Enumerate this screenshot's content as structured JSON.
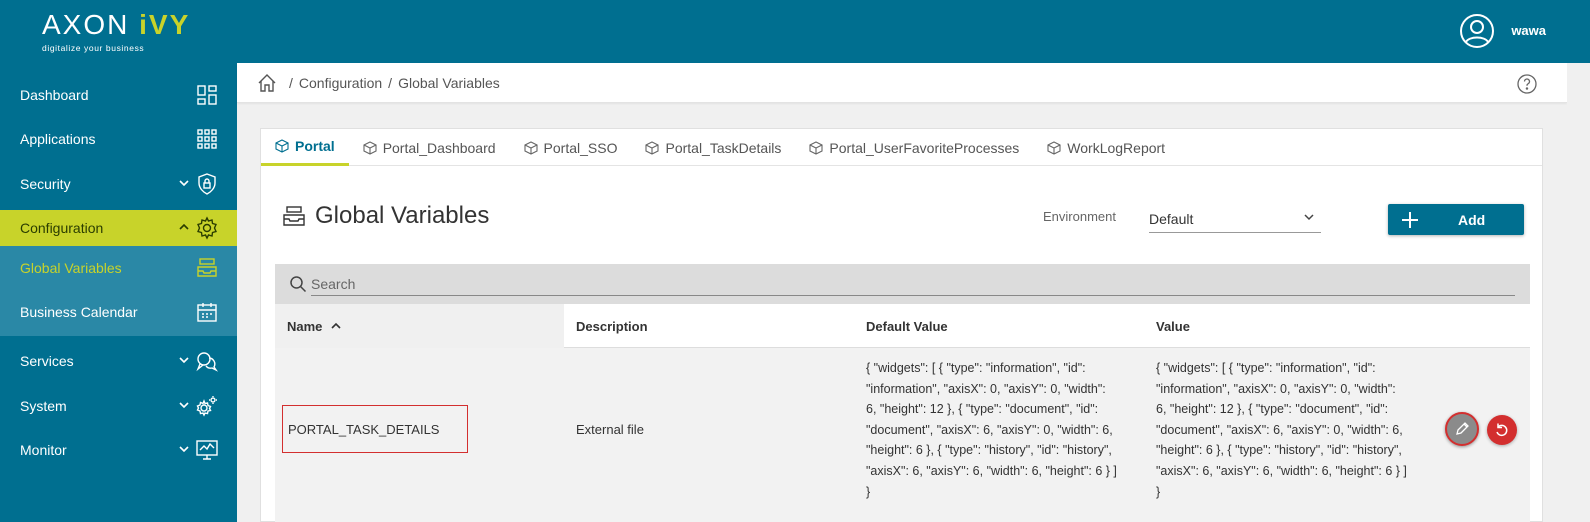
{
  "logo": {
    "brand_main": "AXON ",
    "brand_accent": "iVY",
    "tagline": "digitalize your business"
  },
  "colors": {
    "primary": "#006f90",
    "accent": "#c8d32a",
    "danger": "#d32f2f"
  },
  "sidebar": {
    "items": [
      {
        "label": "Dashboard",
        "icon": "dashboard-icon"
      },
      {
        "label": "Applications",
        "icon": "apps-grid-icon"
      },
      {
        "label": "Security",
        "icon": "shield-lock-icon"
      },
      {
        "label": "Configuration",
        "icon": "gear-icon",
        "active": true
      },
      {
        "label": "Services",
        "icon": "chat-bubbles-icon"
      },
      {
        "label": "System",
        "icon": "gears-icon"
      },
      {
        "label": "Monitor",
        "icon": "monitor-chart-icon"
      }
    ],
    "sub_items": [
      {
        "label": "Global Variables",
        "icon": "inbox-stack-icon",
        "current": true
      },
      {
        "label": "Business Calendar",
        "icon": "calendar-icon"
      }
    ]
  },
  "topbar": {
    "user_name": "wawa",
    "user_icon": "user-circle-icon"
  },
  "breadcrumb": {
    "home_icon": "home-icon",
    "items": [
      "Configuration",
      "Global Variables"
    ],
    "separator": "/"
  },
  "tabs": [
    {
      "label": "Portal",
      "active": true
    },
    {
      "label": "Portal_Dashboard"
    },
    {
      "label": "Portal_SSO"
    },
    {
      "label": "Portal_TaskDetails"
    },
    {
      "label": "Portal_UserFavoriteProcesses"
    },
    {
      "label": "WorkLogReport"
    }
  ],
  "main": {
    "title": "Global Variables",
    "environment_label": "Environment",
    "environment_value": "Default",
    "add_label": "Add",
    "search_placeholder": "Search"
  },
  "table": {
    "headers": [
      "Name",
      "Description",
      "Default Value",
      "Value"
    ],
    "sort_column": "Name",
    "rows": [
      {
        "name": "PORTAL_TASK_DETAILS",
        "description": "External file",
        "default_value_lines": [
          "{ \"widgets\": [ { \"type\": \"information\", \"id\":",
          "\"information\", \"axisX\": 0, \"axisY\": 0, \"width\":",
          "6, \"height\": 12 }, { \"type\": \"document\", \"id\":",
          "\"document\", \"axisX\": 6, \"axisY\": 0, \"width\": 6,",
          "\"height\": 6 }, { \"type\": \"history\", \"id\": \"history\",",
          "\"axisX\": 6, \"axisY\": 6, \"width\": 6, \"height\": 6 } ]",
          "}"
        ],
        "value_lines": [
          "{ \"widgets\": [ { \"type\": \"information\", \"id\":",
          "\"information\", \"axisX\": 0, \"axisY\": 0, \"width\":",
          "6, \"height\": 12 }, { \"type\": \"document\", \"id\":",
          "\"document\", \"axisX\": 6, \"axisY\": 0, \"width\": 6,",
          "\"height\": 6 }, { \"type\": \"history\", \"id\": \"history\",",
          "\"axisX\": 6, \"axisY\": 6, \"width\": 6, \"height\": 6 } ]",
          "}"
        ]
      }
    ]
  }
}
